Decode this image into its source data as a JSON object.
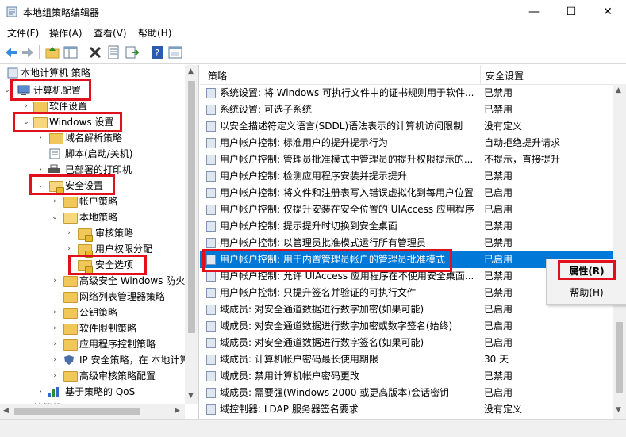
{
  "window": {
    "title": "本地组策略编辑器",
    "min_label": "—",
    "max_label": "☐",
    "close_label": "✕"
  },
  "menu": {
    "file": "文件(F)",
    "action": "操作(A)",
    "view": "查看(V)",
    "help": "帮助(H)"
  },
  "toolbar_icons": [
    "back-icon",
    "forward-icon",
    "up-folder-icon",
    "show-hide-tree-icon",
    "delete-icon",
    "properties-icon",
    "export-list-icon",
    "help-icon",
    "console-icon"
  ],
  "tree": {
    "root": "本地计算机 策略",
    "computer_config": "计算机配置",
    "software_settings": "软件设置",
    "windows_settings": "Windows 设置",
    "dns": "域名解析策略",
    "scripts": "脚本(启动/关机)",
    "printers": "已部署的打印机",
    "security_settings": "安全设置",
    "account_policies": "帐户策略",
    "local_policies": "本地策略",
    "audit_policy": "审核策略",
    "user_rights": "用户权限分配",
    "security_options": "安全选项",
    "firewall": "高级安全 Windows 防火",
    "network_list": "网络列表管理器策略",
    "public_key": "公钥策略",
    "software_restriction": "软件限制策略",
    "app_control": "应用程序控制策略",
    "ipsec": "IP 安全策略，在 本地计算",
    "advanced_audit": "高级审核策略配置",
    "qos": "基于策略的 QoS",
    "last_partial": "计算机..."
  },
  "list": {
    "col_policy": "策略",
    "col_setting": "安全设置",
    "rows": [
      {
        "name": "系统设置: 将 Windows 可执行文件中的证书规则用于软件...",
        "value": "已禁用"
      },
      {
        "name": "系统设置: 可选子系统",
        "value": "已禁用"
      },
      {
        "name": "以安全描述符定义语言(SDDL)语法表示的计算机访问限制",
        "value": "没有定义"
      },
      {
        "name": "用户帐户控制: 标准用户的提升提示行为",
        "value": "自动拒绝提升请求"
      },
      {
        "name": "用户帐户控制: 管理员批准模式中管理员的提升权限提示的...",
        "value": "不提示，直接提升"
      },
      {
        "name": "用户帐户控制: 检测应用程序安装并提示提升",
        "value": "已禁用"
      },
      {
        "name": "用户帐户控制: 将文件和注册表写入错误虚拟化到每用户位置",
        "value": "已启用"
      },
      {
        "name": "用户帐户控制: 仅提升安装在安全位置的 UIAccess 应用程序",
        "value": "已启用"
      },
      {
        "name": "用户帐户控制: 提示提升时切换到安全桌面",
        "value": "已禁用"
      },
      {
        "name": "用户帐户控制: 以管理员批准模式运行所有管理员",
        "value": "已禁用"
      },
      {
        "name": "用户帐户控制: 用于内置管理员帐户的管理员批准模式",
        "value": "已启用"
      },
      {
        "name": "用户帐户控制: 允许 UIAccess 应用程序在不使用安全桌面...",
        "value": "已禁用"
      },
      {
        "name": "用户帐户控制: 只提升签名并验证的可执行文件",
        "value": "已禁用"
      },
      {
        "name": "域成员: 对安全通道数据进行数字加密(如果可能)",
        "value": "已启用"
      },
      {
        "name": "域成员: 对安全通道数据进行数字加密或数字签名(始终)",
        "value": "已启用"
      },
      {
        "name": "域成员: 对安全通道数据进行数字签名(如果可能)",
        "value": "已启用"
      },
      {
        "name": "域成员: 计算机帐户密码最长使用期限",
        "value": "30 天"
      },
      {
        "name": "域成员: 禁用计算机帐户密码更改",
        "value": "已禁用"
      },
      {
        "name": "域成员: 需要强(Windows 2000 或更高版本)会话密钥",
        "value": "已启用"
      },
      {
        "name": "域控制器: LDAP 服务器签名要求",
        "value": "没有定义"
      }
    ]
  },
  "context_menu": {
    "properties": "属性(R)",
    "help": "帮助(H)"
  },
  "colors": {
    "selection": "#0078d7",
    "highlight_box": "#e0101c"
  }
}
